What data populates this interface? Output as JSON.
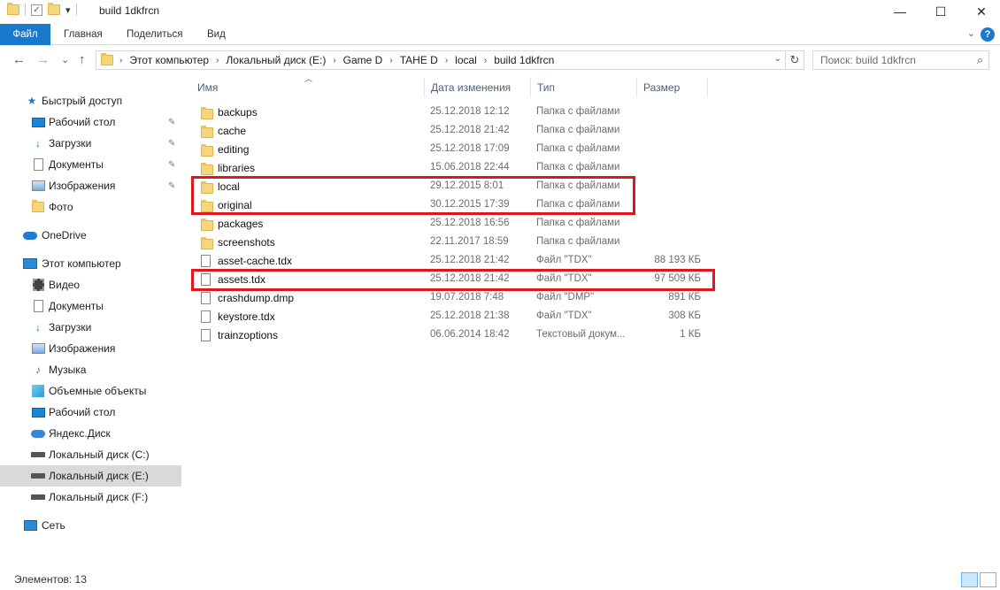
{
  "window": {
    "title": "build 1dkfrcn",
    "qat_dropdown": "▾",
    "minimize": "—",
    "maximize": "☐",
    "close": "✕"
  },
  "ribbon": {
    "tabs": [
      "Файл",
      "Главная",
      "Поделиться",
      "Вид"
    ],
    "help": "?",
    "expand": "⌄"
  },
  "nav": {
    "back": "←",
    "forward": "→",
    "recent": "⌄",
    "up": "↑"
  },
  "address": {
    "crumbs": [
      "Этот компьютер",
      "Локальный диск (E:)",
      "Game D",
      "TAHE D",
      "local",
      "build 1dkfrcn"
    ],
    "dropdown": "⌄",
    "refresh": "↻"
  },
  "search": {
    "placeholder": "Поиск: build 1dkfrcn"
  },
  "sidebar": {
    "quick_access": "Быстрый доступ",
    "items": [
      {
        "label": "Рабочий стол",
        "icon": "desktop-icon",
        "pinned": true
      },
      {
        "label": "Загрузки",
        "icon": "downloads-icon",
        "pinned": true
      },
      {
        "label": "Документы",
        "icon": "documents-icon",
        "pinned": true
      },
      {
        "label": "Изображения",
        "icon": "pictures-icon",
        "pinned": true
      },
      {
        "label": "Фото",
        "icon": "folder-icon",
        "pinned": false
      }
    ],
    "onedrive": "OneDrive",
    "this_pc": "Этот компьютер",
    "pc_items": [
      {
        "label": "Видео",
        "icon": "video-icon"
      },
      {
        "label": "Документы",
        "icon": "documents-icon"
      },
      {
        "label": "Загрузки",
        "icon": "downloads-icon"
      },
      {
        "label": "Изображения",
        "icon": "pictures-icon"
      },
      {
        "label": "Музыка",
        "icon": "music-icon"
      },
      {
        "label": "Объемные объекты",
        "icon": "3d-objects-icon"
      },
      {
        "label": "Рабочий стол",
        "icon": "desktop-icon"
      },
      {
        "label": "Яндекс.Диск",
        "icon": "yandex-disk-icon"
      },
      {
        "label": "Локальный диск (C:)",
        "icon": "drive-icon"
      },
      {
        "label": "Локальный диск (E:)",
        "icon": "drive-icon",
        "selected": true
      },
      {
        "label": "Локальный диск (F:)",
        "icon": "drive-icon"
      }
    ],
    "network": "Сеть",
    "pin_glyph": "📌"
  },
  "columns": {
    "name": "Имя",
    "date": "Дата изменения",
    "type": "Тип",
    "size": "Размер"
  },
  "files": [
    {
      "name": "backups",
      "date": "25.12.2018 12:12",
      "type": "Папка с файлами",
      "size": "",
      "kind": "folder"
    },
    {
      "name": "cache",
      "date": "25.12.2018 21:42",
      "type": "Папка с файлами",
      "size": "",
      "kind": "folder"
    },
    {
      "name": "editing",
      "date": "25.12.2018 17:09",
      "type": "Папка с файлами",
      "size": "",
      "kind": "folder"
    },
    {
      "name": "libraries",
      "date": "15.06.2018 22:44",
      "type": "Папка с файлами",
      "size": "",
      "kind": "folder"
    },
    {
      "name": "local",
      "date": "29.12.2015 8:01",
      "type": "Папка с файлами",
      "size": "",
      "kind": "folder"
    },
    {
      "name": "original",
      "date": "30.12.2015 17:39",
      "type": "Папка с файлами",
      "size": "",
      "kind": "folder"
    },
    {
      "name": "packages",
      "date": "25.12.2018 16:56",
      "type": "Папка с файлами",
      "size": "",
      "kind": "folder"
    },
    {
      "name": "screenshots",
      "date": "22.11.2017 18:59",
      "type": "Папка с файлами",
      "size": "",
      "kind": "folder"
    },
    {
      "name": "asset-cache.tdx",
      "date": "25.12.2018 21:42",
      "type": "Файл \"TDX\"",
      "size": "88 193 КБ",
      "kind": "file"
    },
    {
      "name": "assets.tdx",
      "date": "25.12.2018 21:42",
      "type": "Файл \"TDX\"",
      "size": "97 509 КБ",
      "kind": "file"
    },
    {
      "name": "crashdump.dmp",
      "date": "19.07.2018 7:48",
      "type": "Файл \"DMP\"",
      "size": "891 КБ",
      "kind": "file"
    },
    {
      "name": "keystore.tdx",
      "date": "25.12.2018 21:38",
      "type": "Файл \"TDX\"",
      "size": "308 КБ",
      "kind": "file"
    },
    {
      "name": "trainzoptions",
      "date": "06.06.2014 18:42",
      "type": "Текстовый докум...",
      "size": "1 КБ",
      "kind": "file"
    }
  ],
  "status": {
    "items_count": "Элементов: 13"
  },
  "colors": {
    "accent": "#1979ca",
    "highlight_border": "#e0161f",
    "selected_nav": "#d9d9d9"
  }
}
